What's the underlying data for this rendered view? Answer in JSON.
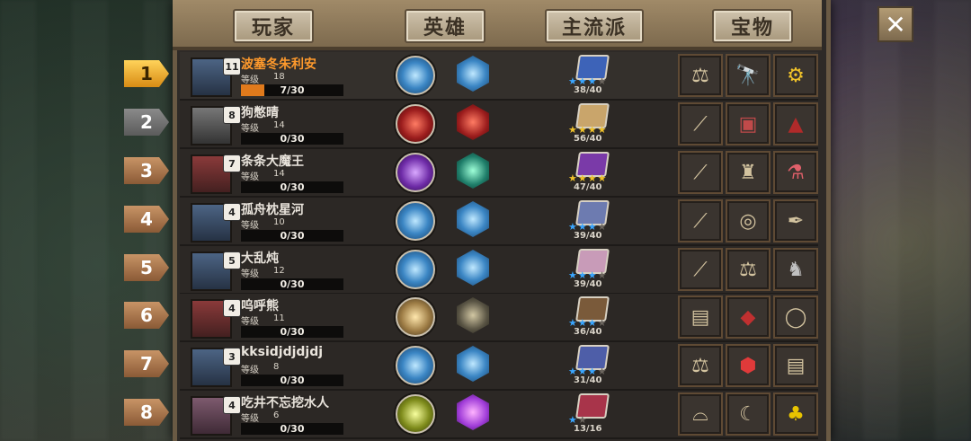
{
  "tabs": [
    "玩家",
    "英雄",
    "主流派",
    "宝物"
  ],
  "close_icon": "close-x-icon",
  "level_label": "等级",
  "rows": [
    {
      "rank": "1",
      "name": "波塞冬朱利安",
      "badge": "11",
      "level": "18",
      "xp": "7/30",
      "xp_fraction": 0.23,
      "score": "38/40",
      "stars": 3,
      "star_color": "blue",
      "items": [
        "balance-scale-icon",
        "telescope-icon",
        "gear-icon"
      ]
    },
    {
      "rank": "2",
      "name": "狗憋晴",
      "badge": "8",
      "level": "14",
      "xp": "0/30",
      "xp_fraction": 0.0,
      "score": "56/40",
      "stars": 4,
      "star_color": "gold",
      "items": [
        "staff-icon",
        "spellbook-icon",
        "red-hood-icon"
      ]
    },
    {
      "rank": "3",
      "name": "条条大魔王",
      "badge": "7",
      "level": "14",
      "xp": "0/30",
      "xp_fraction": 0.0,
      "score": "47/40",
      "stars": 4,
      "star_color": "gold",
      "items": [
        "staff-icon",
        "lantern-icon",
        "potion-icon"
      ]
    },
    {
      "rank": "4",
      "name": "孤舟枕星河",
      "badge": "4",
      "level": "10",
      "xp": "0/30",
      "xp_fraction": 0.0,
      "score": "39/40",
      "stars": 3,
      "star_color": "blue",
      "items": [
        "staff-icon",
        "compass-icon",
        "ink-bottle-icon"
      ]
    },
    {
      "rank": "5",
      "name": "大乱炖",
      "badge": "5",
      "level": "12",
      "xp": "0/30",
      "xp_fraction": 0.0,
      "score": "39/40",
      "stars": 3,
      "star_color": "blue",
      "items": [
        "staff-icon",
        "balance-scale-icon",
        "helmet-icon"
      ]
    },
    {
      "rank": "6",
      "name": "呜呼熊",
      "badge": "4",
      "level": "11",
      "xp": "0/30",
      "xp_fraction": 0.0,
      "score": "36/40",
      "stars": 3,
      "star_color": "blue",
      "items": [
        "scroll-icon",
        "red-amulet-icon",
        "ring-icon"
      ]
    },
    {
      "rank": "7",
      "name": "kksidjdjdjdj",
      "badge": "3",
      "level": "8",
      "xp": "0/30",
      "xp_fraction": 0.0,
      "score": "31/40",
      "stars": 3,
      "star_color": "blue",
      "items": [
        "balance-scale-icon",
        "red-gem-icon",
        "scroll-icon"
      ]
    },
    {
      "rank": "8",
      "name": "吃井不忘挖水人",
      "badge": "4",
      "level": "6",
      "xp": "0/30",
      "xp_fraction": 0.0,
      "score": "13/16",
      "stars": 1,
      "star_color": "blue",
      "items": [
        "shoe-icon",
        "horn-icon",
        "clover-icon"
      ]
    }
  ]
}
